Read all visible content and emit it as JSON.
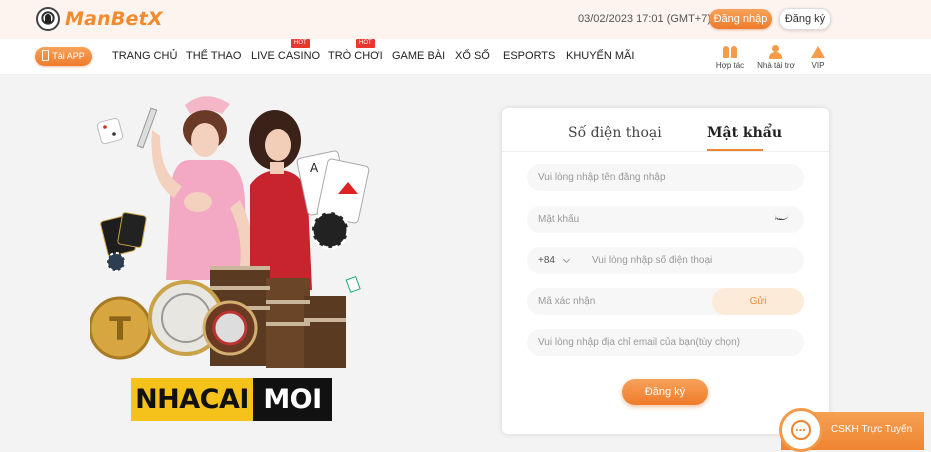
{
  "brand": {
    "name": "ManBetX"
  },
  "header": {
    "datetime": "03/02/2023 17:01  (GMT+7)",
    "login_label": "Đăng nhập",
    "register_label": "Đăng ký"
  },
  "nav": {
    "app_label": "Tải APP",
    "items": [
      {
        "label": "TRANG CHỦ",
        "hot": ""
      },
      {
        "label": "THỂ THAO",
        "hot": ""
      },
      {
        "label": "LIVE CASINO",
        "hot": "HOT"
      },
      {
        "label": "TRÒ CHƠI",
        "hot": "HOT"
      },
      {
        "label": "GAME BÀI",
        "hot": ""
      },
      {
        "label": "XỔ SỐ",
        "hot": ""
      },
      {
        "label": "ESPORTS",
        "hot": ""
      },
      {
        "label": "KHUYẾN MÃI",
        "hot": ""
      }
    ],
    "quick": [
      {
        "label": "Hợp tác",
        "icon": "handshake-icon"
      },
      {
        "label": "Nhà tài trợ",
        "icon": "sponsor-icon"
      },
      {
        "label": "VIP",
        "icon": "crown-icon"
      }
    ]
  },
  "watermark": {
    "part_a": "NHACAI",
    "part_b": "MOI"
  },
  "form": {
    "tabs": [
      {
        "label": "Số điện thoại",
        "active": false
      },
      {
        "label": "Mật khẩu",
        "active": true
      }
    ],
    "username_placeholder": "Vui lòng nhập tên đăng nhập",
    "password_placeholder": "Mật khẩu",
    "country_code": "+84",
    "phone_placeholder": "Vui lòng nhập số điện thoại",
    "code_placeholder": "Mã xác nhận",
    "send_label": "Gửi",
    "email_placeholder": "Vui lòng nhập địa chỉ email của bạn(tùy chọn)",
    "submit_label": "Đăng ký"
  },
  "support": {
    "label": "CSKH Trực Tuyến"
  },
  "colors": {
    "accent": "#ee7b2a",
    "hot": "#e8372c",
    "watermark_yellow": "#f4c21a"
  }
}
